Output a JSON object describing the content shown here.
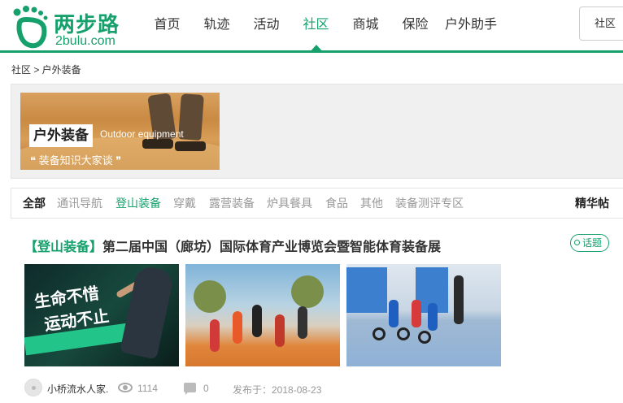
{
  "header": {
    "logo_cn": "两步路",
    "logo_en": "2bulu.com",
    "nav": [
      {
        "label": "首页"
      },
      {
        "label": "轨迹"
      },
      {
        "label": "活动"
      },
      {
        "label": "社区"
      },
      {
        "label": "商城"
      },
      {
        "label": "保险"
      },
      {
        "label": "户外助手"
      }
    ],
    "active_nav": "社区",
    "search_scope": "社区"
  },
  "breadcrumb": "社区 > 户外装备",
  "banner": {
    "title": "户外装备",
    "title_en": "Outdoor equipment",
    "slogan": "❝ 装备知识大家谈 ❞"
  },
  "tabs": [
    {
      "label": "全部"
    },
    {
      "label": "通讯导航"
    },
    {
      "label": "登山装备"
    },
    {
      "label": "穿戴"
    },
    {
      "label": "露营装备"
    },
    {
      "label": "炉具餐具"
    },
    {
      "label": "食品"
    },
    {
      "label": "其他"
    },
    {
      "label": "装备测评专区"
    }
  ],
  "featured_tab": "精华帖",
  "post": {
    "tag": "【登山装备】",
    "title": "第二届中国（廊坊）国际体育产业博览会暨智能体育装备展",
    "badge": "话题",
    "thumb1_text1": "生命不惜",
    "thumb1_text2": "运动不止",
    "author": "小桥流水人家.",
    "views": "1114",
    "comments": "0",
    "published": "发布于：2018-08-23"
  },
  "colors": {
    "brand": "#16a16c",
    "text": "#333333",
    "muted": "#999999"
  }
}
